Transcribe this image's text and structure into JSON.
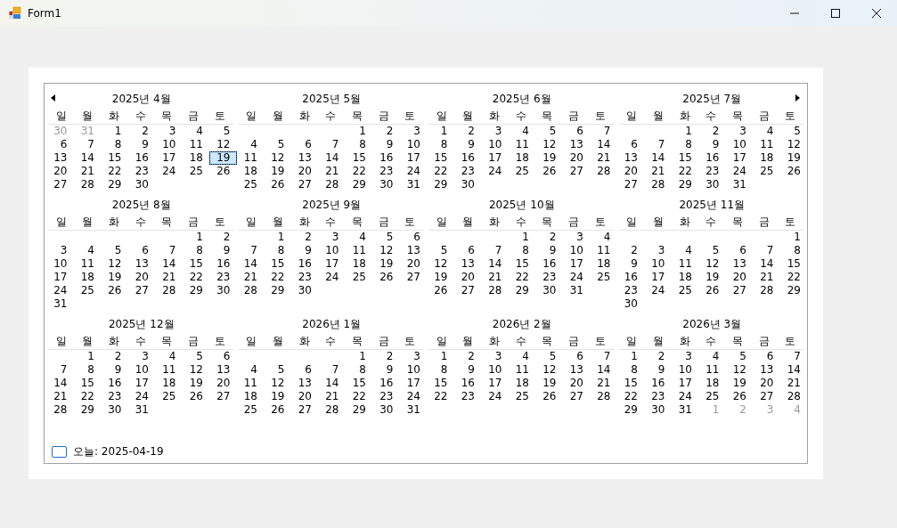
{
  "window": {
    "title": "Form1"
  },
  "calendar": {
    "months": [
      {
        "title": "2025년 4월",
        "weekdays": [
          "일",
          "월",
          "화",
          "수",
          "목",
          "금",
          "토"
        ],
        "weeks": [
          [
            {
              "d": "30",
              "trailing": true
            },
            {
              "d": "31",
              "trailing": true
            },
            "1",
            "2",
            "3",
            "4",
            "5"
          ],
          [
            "6",
            "7",
            "8",
            "9",
            "10",
            "11",
            "12"
          ],
          [
            "13",
            "14",
            "15",
            "16",
            "17",
            "18",
            {
              "d": "19",
              "selected": true
            }
          ],
          [
            "20",
            "21",
            "22",
            "23",
            "24",
            "25",
            "26"
          ],
          [
            "27",
            "28",
            "29",
            "30"
          ]
        ]
      },
      {
        "title": "2025년 5월",
        "weekdays": [
          "일",
          "월",
          "화",
          "수",
          "목",
          "금",
          "토"
        ],
        "weeks": [
          [
            "1",
            "2",
            "3"
          ],
          [
            "4",
            "5",
            "6",
            "7",
            "8",
            "9",
            "10"
          ],
          [
            "11",
            "12",
            "13",
            "14",
            "15",
            "16",
            "17"
          ],
          [
            "18",
            "19",
            "20",
            "21",
            "22",
            "23",
            "24"
          ],
          [
            "25",
            "26",
            "27",
            "28",
            "29",
            "30",
            "31"
          ]
        ]
      },
      {
        "title": "2025년 6월",
        "weekdays": [
          "일",
          "월",
          "화",
          "수",
          "목",
          "금",
          "토"
        ],
        "weeks": [
          [
            "1",
            "2",
            "3",
            "4",
            "5",
            "6",
            "7"
          ],
          [
            "8",
            "9",
            "10",
            "11",
            "12",
            "13",
            "14"
          ],
          [
            "15",
            "16",
            "17",
            "18",
            "19",
            "20",
            "21"
          ],
          [
            "22",
            "23",
            "24",
            "25",
            "26",
            "27",
            "28"
          ],
          [
            "29",
            "30"
          ]
        ]
      },
      {
        "title": "2025년 7월",
        "weekdays": [
          "일",
          "월",
          "화",
          "수",
          "목",
          "금",
          "토"
        ],
        "weeks": [
          [
            "1",
            "2",
            "3",
            "4",
            "5"
          ],
          [
            "6",
            "7",
            "8",
            "9",
            "10",
            "11",
            "12"
          ],
          [
            "13",
            "14",
            "15",
            "16",
            "17",
            "18",
            "19"
          ],
          [
            "20",
            "21",
            "22",
            "23",
            "24",
            "25",
            "26"
          ],
          [
            "27",
            "28",
            "29",
            "30",
            "31"
          ]
        ]
      },
      {
        "title": "2025년 8월",
        "weekdays": [
          "일",
          "월",
          "화",
          "수",
          "목",
          "금",
          "토"
        ],
        "weeks": [
          [
            "1",
            "2"
          ],
          [
            "3",
            "4",
            "5",
            "6",
            "7",
            "8",
            "9"
          ],
          [
            "10",
            "11",
            "12",
            "13",
            "14",
            "15",
            "16"
          ],
          [
            "17",
            "18",
            "19",
            "20",
            "21",
            "22",
            "23"
          ],
          [
            "24",
            "25",
            "26",
            "27",
            "28",
            "29",
            "30"
          ],
          [
            "31"
          ]
        ]
      },
      {
        "title": "2025년 9월",
        "weekdays": [
          "일",
          "월",
          "화",
          "수",
          "목",
          "금",
          "토"
        ],
        "weeks": [
          [
            "1",
            "2",
            "3",
            "4",
            "5",
            "6"
          ],
          [
            "7",
            "8",
            "9",
            "10",
            "11",
            "12",
            "13"
          ],
          [
            "14",
            "15",
            "16",
            "17",
            "18",
            "19",
            "20"
          ],
          [
            "21",
            "22",
            "23",
            "24",
            "25",
            "26",
            "27"
          ],
          [
            "28",
            "29",
            "30"
          ]
        ]
      },
      {
        "title": "2025년 10월",
        "weekdays": [
          "일",
          "월",
          "화",
          "수",
          "목",
          "금",
          "토"
        ],
        "weeks": [
          [
            "1",
            "2",
            "3",
            "4"
          ],
          [
            "5",
            "6",
            "7",
            "8",
            "9",
            "10",
            "11"
          ],
          [
            "12",
            "13",
            "14",
            "15",
            "16",
            "17",
            "18"
          ],
          [
            "19",
            "20",
            "21",
            "22",
            "23",
            "24",
            "25"
          ],
          [
            "26",
            "27",
            "28",
            "29",
            "30",
            "31"
          ]
        ]
      },
      {
        "title": "2025년 11월",
        "weekdays": [
          "일",
          "월",
          "화",
          "수",
          "목",
          "금",
          "토"
        ],
        "weeks": [
          [
            "1"
          ],
          [
            "2",
            "3",
            "4",
            "5",
            "6",
            "7",
            "8"
          ],
          [
            "9",
            "10",
            "11",
            "12",
            "13",
            "14",
            "15"
          ],
          [
            "16",
            "17",
            "18",
            "19",
            "20",
            "21",
            "22"
          ],
          [
            "23",
            "24",
            "25",
            "26",
            "27",
            "28",
            "29"
          ],
          [
            "30"
          ]
        ]
      },
      {
        "title": "2025년 12월",
        "weekdays": [
          "일",
          "월",
          "화",
          "수",
          "목",
          "금",
          "토"
        ],
        "weeks": [
          [
            "1",
            "2",
            "3",
            "4",
            "5",
            "6"
          ],
          [
            "7",
            "8",
            "9",
            "10",
            "11",
            "12",
            "13"
          ],
          [
            "14",
            "15",
            "16",
            "17",
            "18",
            "19",
            "20"
          ],
          [
            "21",
            "22",
            "23",
            "24",
            "25",
            "26",
            "27"
          ],
          [
            "28",
            "29",
            "30",
            "31"
          ]
        ]
      },
      {
        "title": "2026년 1월",
        "weekdays": [
          "일",
          "월",
          "화",
          "수",
          "목",
          "금",
          "토"
        ],
        "weeks": [
          [
            "1",
            "2",
            "3"
          ],
          [
            "4",
            "5",
            "6",
            "7",
            "8",
            "9",
            "10"
          ],
          [
            "11",
            "12",
            "13",
            "14",
            "15",
            "16",
            "17"
          ],
          [
            "18",
            "19",
            "20",
            "21",
            "22",
            "23",
            "24"
          ],
          [
            "25",
            "26",
            "27",
            "28",
            "29",
            "30",
            "31"
          ]
        ]
      },
      {
        "title": "2026년 2월",
        "weekdays": [
          "일",
          "월",
          "화",
          "수",
          "목",
          "금",
          "토"
        ],
        "weeks": [
          [
            "1",
            "2",
            "3",
            "4",
            "5",
            "6",
            "7"
          ],
          [
            "8",
            "9",
            "10",
            "11",
            "12",
            "13",
            "14"
          ],
          [
            "15",
            "16",
            "17",
            "18",
            "19",
            "20",
            "21"
          ],
          [
            "22",
            "23",
            "24",
            "25",
            "26",
            "27",
            "28"
          ]
        ]
      },
      {
        "title": "2026년 3월",
        "weekdays": [
          "일",
          "월",
          "화",
          "수",
          "목",
          "금",
          "토"
        ],
        "weeks": [
          [
            "1",
            "2",
            "3",
            "4",
            "5",
            "6",
            "7"
          ],
          [
            "8",
            "9",
            "10",
            "11",
            "12",
            "13",
            "14"
          ],
          [
            "15",
            "16",
            "17",
            "18",
            "19",
            "20",
            "21"
          ],
          [
            "22",
            "23",
            "24",
            "25",
            "26",
            "27",
            "28"
          ],
          [
            "29",
            "30",
            "31",
            {
              "d": "1",
              "trailing": true
            },
            {
              "d": "2",
              "trailing": true
            },
            {
              "d": "3",
              "trailing": true
            },
            {
              "d": "4",
              "trailing": true
            }
          ]
        ]
      }
    ],
    "today": "오늘: 2025-04-19"
  }
}
